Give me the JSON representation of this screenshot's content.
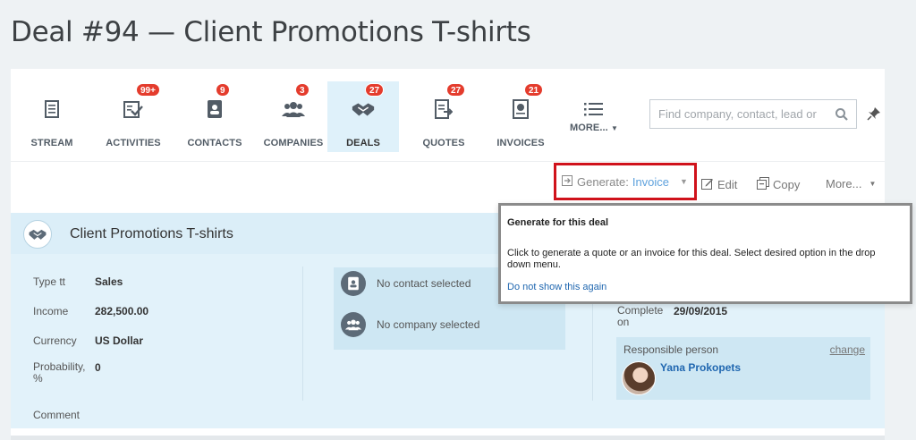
{
  "page_title": "Deal #94 — Client Promotions T-shirts",
  "nav": [
    {
      "label": "STREAM",
      "badge": "",
      "icon": "stream-icon"
    },
    {
      "label": "ACTIVITIES",
      "badge": "99+",
      "icon": "activities-icon"
    },
    {
      "label": "CONTACTS",
      "badge": "9",
      "icon": "contacts-icon"
    },
    {
      "label": "COMPANIES",
      "badge": "3",
      "icon": "companies-icon"
    },
    {
      "label": "DEALS",
      "badge": "27",
      "icon": "deals-icon",
      "active": true
    },
    {
      "label": "QUOTES",
      "badge": "27",
      "icon": "quotes-icon"
    },
    {
      "label": "INVOICES",
      "badge": "21",
      "icon": "invoices-icon"
    },
    {
      "label": "MORE...",
      "badge": "",
      "icon": "more-list-icon"
    }
  ],
  "search": {
    "placeholder": "Find company, contact, lead or"
  },
  "actions": {
    "generate_label": "Generate:",
    "generate_value": "Invoice",
    "edit": "Edit",
    "copy": "Copy",
    "more": "More..."
  },
  "deal": {
    "title": "Client Promotions T-shirts",
    "fields": [
      {
        "label": "Type tt",
        "value": "Sales"
      },
      {
        "label": "Income",
        "value": "282,500.00"
      },
      {
        "label": "Currency",
        "value": "US Dollar"
      },
      {
        "label": "Probability, %",
        "value": "0"
      },
      {
        "label": "Comment",
        "value": ""
      }
    ],
    "contact": "No contact selected",
    "company": "No company selected",
    "complete_label": "Complete on",
    "complete_value": "29/09/2015",
    "responsible_label": "Responsible person",
    "responsible_change": "change",
    "responsible_name": "Yana Prokopets"
  },
  "tooltip": {
    "title": "Generate for this deal",
    "text": "Click to generate a quote or an invoice for this deal. Select desired option in the drop down menu.",
    "link": "Do not show this again"
  },
  "colors": {
    "accent": "#2067b0",
    "badge": "#e43c2d",
    "highlight_border": "#d0121b",
    "active_tab": "#dff1fa"
  }
}
